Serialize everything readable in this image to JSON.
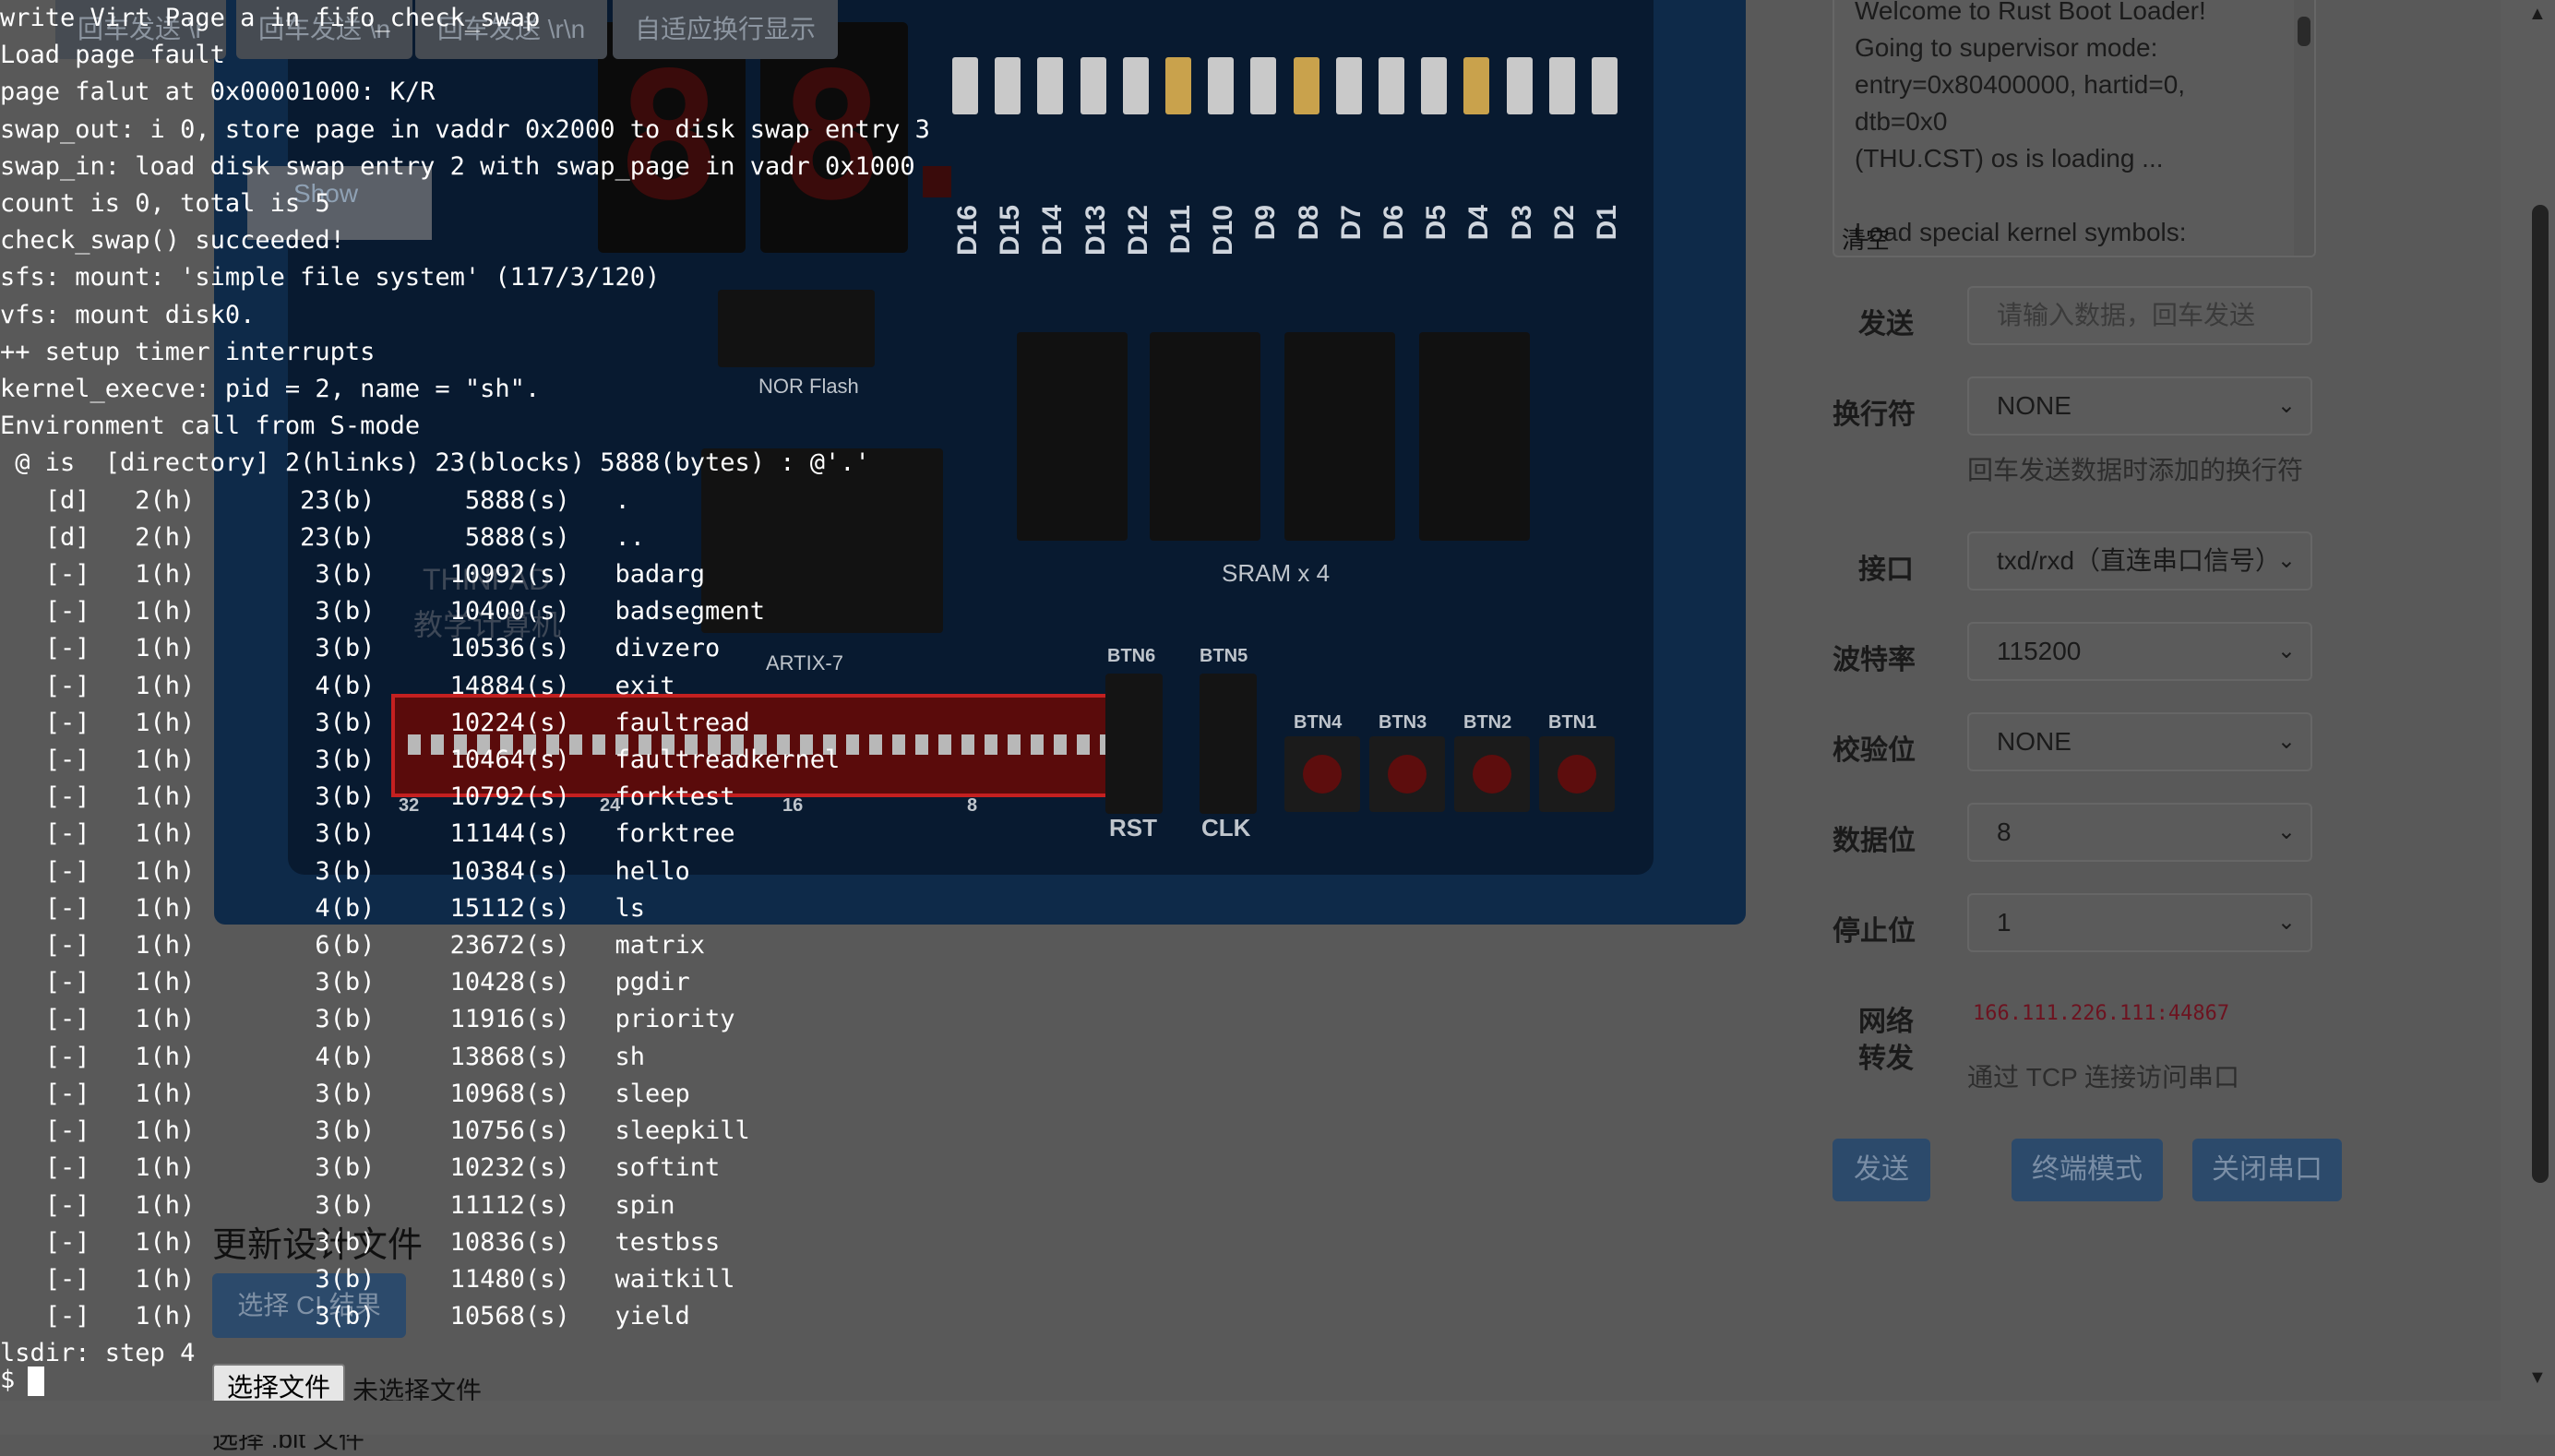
{
  "tabs": [
    "回车发送 \\r",
    "回车发送 \\n",
    "回车发送 \\r\\n",
    "自适应换行显示"
  ],
  "show_button": "Show",
  "board": {
    "leds": [
      {
        "label": "D16",
        "on": false
      },
      {
        "label": "D15",
        "on": false
      },
      {
        "label": "D14",
        "on": false
      },
      {
        "label": "D13",
        "on": false
      },
      {
        "label": "D12",
        "on": false
      },
      {
        "label": "D11",
        "on": true
      },
      {
        "label": "D10",
        "on": false
      },
      {
        "label": "D9",
        "on": false
      },
      {
        "label": "D8",
        "on": true
      },
      {
        "label": "D7",
        "on": false
      },
      {
        "label": "D6",
        "on": false
      },
      {
        "label": "D5",
        "on": false
      },
      {
        "label": "D4",
        "on": true
      },
      {
        "label": "D3",
        "on": false
      },
      {
        "label": "D2",
        "on": false
      },
      {
        "label": "D1",
        "on": false
      }
    ],
    "seg_digits": [
      "8.",
      "8."
    ],
    "nor_flash_label": "NOR Flash",
    "sram_label": "SRAM x 4",
    "fpga_label": "ARTIX-7",
    "logo_text_1": "THINPAD",
    "logo_text_2": "教学计算机",
    "slide_buttons": [
      "BTN6",
      "BTN5"
    ],
    "slide_sublabels": [
      "RST",
      "CLK"
    ],
    "push_buttons": [
      "BTN4",
      "BTN3",
      "BTN2",
      "BTN1"
    ],
    "dip_numbers": [
      "32",
      "24",
      "16",
      "8"
    ]
  },
  "update_design_heading": "更新设计文件",
  "select_ci_button": "选择 CI 结果",
  "file_picker": {
    "button": "选择文件",
    "status": "未选择文件"
  },
  "bit_file_hint": "选择 .bit 文件",
  "serial_log": "Welcome to Rust Boot Loader!\nGoing to supervisor mode:\nentry=0x80400000, hartid=0,\ndtb=0x0\n(THU.CST) os is loading ...\n\nLoad special kernel symbols:",
  "clear_label": "清空",
  "form": {
    "send_label": "发送",
    "send_placeholder": "请输入数据，回车发送",
    "newline_label": "换行符",
    "newline_value": "NONE",
    "newline_help": "回车发送数据时添加的换行符",
    "port_label": "接口",
    "port_value": "txd/rxd（直连串口信号）",
    "baud_label": "波特率",
    "baud_value": "115200",
    "parity_label": "校验位",
    "parity_value": "NONE",
    "databits_label": "数据位",
    "databits_value": "8",
    "stopbits_label": "停止位",
    "stopbits_value": "1",
    "net_label_1": "网络",
    "net_label_2": "转发",
    "net_address": "166.111.226.111:44867",
    "net_help": "通过 TCP 连接访问串口"
  },
  "buttons": {
    "send": "发送",
    "terminal_mode": "终端模式",
    "close_port": "关闭串口"
  },
  "terminal": {
    "lines": [
      "write Virt Page a in fifo_check_swap",
      "Load page fault",
      "page falut at 0x00001000: K/R",
      "swap_out: i 0, store page in vaddr 0x2000 to disk swap entry 3",
      "swap_in: load disk swap entry 2 with swap_page in vadr 0x1000",
      "count is 0, total is 5",
      "check_swap() succeeded!",
      "sfs: mount: 'simple file system' (117/3/120)",
      "vfs: mount disk0.",
      "++ setup timer interrupts",
      "kernel_execve: pid = 2, name = \"sh\".",
      "Environment call from S-mode",
      " @ is  [directory] 2(hlinks) 23(blocks) 5888(bytes) : @'.'",
      "   [d]   2(h)       23(b)      5888(s)   .",
      "   [d]   2(h)       23(b)      5888(s)   ..",
      "   [-]   1(h)        3(b)     10992(s)   badarg",
      "   [-]   1(h)        3(b)     10400(s)   badsegment",
      "   [-]   1(h)        3(b)     10536(s)   divzero",
      "   [-]   1(h)        4(b)     14884(s)   exit",
      "   [-]   1(h)        3(b)     10224(s)   faultread",
      "   [-]   1(h)        3(b)     10464(s)   faultreadkernel",
      "   [-]   1(h)        3(b)     10792(s)   forktest",
      "   [-]   1(h)        3(b)     11144(s)   forktree",
      "   [-]   1(h)        3(b)     10384(s)   hello",
      "   [-]   1(h)        4(b)     15112(s)   ls",
      "   [-]   1(h)        6(b)     23672(s)   matrix",
      "   [-]   1(h)        3(b)     10428(s)   pgdir",
      "   [-]   1(h)        3(b)     11916(s)   priority",
      "   [-]   1(h)        4(b)     13868(s)   sh",
      "   [-]   1(h)        3(b)     10968(s)   sleep",
      "   [-]   1(h)        3(b)     10756(s)   sleepkill",
      "   [-]   1(h)        3(b)     10232(s)   softint",
      "   [-]   1(h)        3(b)     11112(s)   spin",
      "   [-]   1(h)        3(b)     10836(s)   testbss",
      "   [-]   1(h)        3(b)     11480(s)   waitkill",
      "   [-]   1(h)        3(b)     10568(s)   yield",
      "lsdir: step 4"
    ],
    "prompt": "$"
  }
}
